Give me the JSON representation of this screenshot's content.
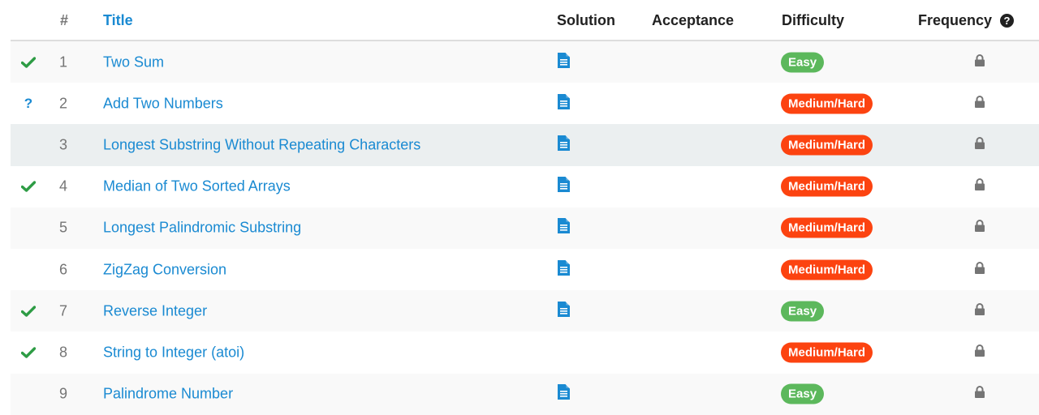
{
  "header": {
    "num": "#",
    "title": "Title",
    "solution": "Solution",
    "acceptance": "Acceptance",
    "difficulty": "Difficulty",
    "frequency": "Frequency",
    "help_icon": "?"
  },
  "colors": {
    "link": "#1a8ad2",
    "easy": "#5cb85c",
    "medium_hard": "#fc4310",
    "solved_check": "#2e9c45",
    "lock": "#757575"
  },
  "rows": [
    {
      "status": "solved",
      "status_glyph": "✔",
      "num": "1",
      "title": "Two Sum",
      "solution": true,
      "acceptance": "",
      "difficulty": "Easy",
      "difficulty_level": "easy",
      "frequency": "locked"
    },
    {
      "status": "attempted",
      "status_glyph": "?",
      "num": "2",
      "title": "Add Two Numbers",
      "solution": true,
      "acceptance": "",
      "difficulty": "Medium/Hard",
      "difficulty_level": "medium",
      "frequency": "locked"
    },
    {
      "status": "none",
      "status_glyph": "",
      "num": "3",
      "title": "Longest Substring Without Repeating Characters",
      "solution": true,
      "acceptance": "",
      "difficulty": "Medium/Hard",
      "difficulty_level": "medium",
      "frequency": "locked"
    },
    {
      "status": "solved",
      "status_glyph": "✔",
      "num": "4",
      "title": "Median of Two Sorted Arrays",
      "solution": true,
      "acceptance": "",
      "difficulty": "Medium/Hard",
      "difficulty_level": "medium",
      "frequency": "locked"
    },
    {
      "status": "none",
      "status_glyph": "",
      "num": "5",
      "title": "Longest Palindromic Substring",
      "solution": true,
      "acceptance": "",
      "difficulty": "Medium/Hard",
      "difficulty_level": "medium",
      "frequency": "locked"
    },
    {
      "status": "none",
      "status_glyph": "",
      "num": "6",
      "title": "ZigZag Conversion",
      "solution": true,
      "acceptance": "",
      "difficulty": "Medium/Hard",
      "difficulty_level": "medium",
      "frequency": "locked"
    },
    {
      "status": "solved",
      "status_glyph": "✔",
      "num": "7",
      "title": "Reverse Integer",
      "solution": true,
      "acceptance": "",
      "difficulty": "Easy",
      "difficulty_level": "easy",
      "frequency": "locked"
    },
    {
      "status": "solved",
      "status_glyph": "✔",
      "num": "8",
      "title": "String to Integer (atoi)",
      "solution": false,
      "acceptance": "",
      "difficulty": "Medium/Hard",
      "difficulty_level": "medium",
      "frequency": "locked"
    },
    {
      "status": "none",
      "status_glyph": "",
      "num": "9",
      "title": "Palindrome Number",
      "solution": true,
      "acceptance": "",
      "difficulty": "Easy",
      "difficulty_level": "easy",
      "frequency": "locked"
    }
  ]
}
